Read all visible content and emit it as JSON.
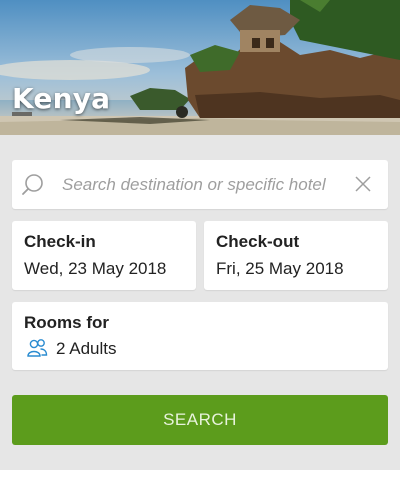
{
  "hero": {
    "title": "Kenya"
  },
  "search": {
    "placeholder": "Search destination or specific hotel"
  },
  "checkin": {
    "label": "Check-in",
    "value": "Wed, 23 May 2018"
  },
  "checkout": {
    "label": "Check-out",
    "value": "Fri, 25 May 2018"
  },
  "rooms": {
    "label": "Rooms for",
    "value": "2 Adults"
  },
  "search_button": {
    "label": "SEARCH"
  },
  "colors": {
    "accent": "#5c9c1c",
    "guests_icon": "#2a8bd0"
  }
}
